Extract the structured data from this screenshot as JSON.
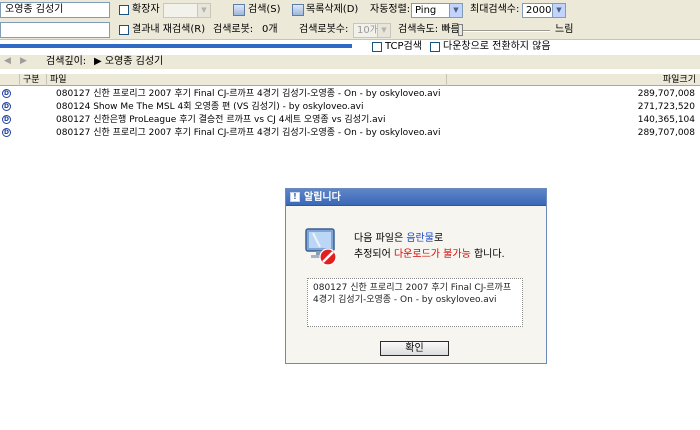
{
  "search": {
    "query": "오영종 김성기",
    "ext_checkbox_label": "확장자",
    "ext_select_value": "",
    "search_button_label": "검색(S)",
    "list_delete_label": "목록삭제(D)",
    "auto_sort_label": "자동정렬:",
    "auto_sort_value": "Ping",
    "max_results_label": "최대검색수:",
    "max_results_value": "2000개",
    "result_research_label": "결과내 재검색(R)",
    "result_count_label": "검색로봇:",
    "result_count_value": "0개",
    "robot_count_label": "검색로봇수:",
    "robot_count_value": "10개",
    "speed_label": "검색속도: 빠름",
    "speed_slow": "느림",
    "tcp_label": "TCP검색",
    "no_switch_label": "다운창으로 전환하지 않음"
  },
  "depth": {
    "label": "검색깊이:",
    "path": "▶ 오영종 김성기"
  },
  "grid": {
    "columns": [
      "구분",
      "파일",
      "파일크기"
    ],
    "rows": [
      {
        "name": "080127 신한 프로리그 2007 후기 Final CJ-르까프 4경기 김성기-오영종 - On - by oskyloveo.avi",
        "size": "289,707,008"
      },
      {
        "name": "080124 Show Me The MSL 4회 오영종 편 (VS 김성기) - by oskyloveo.avi",
        "size": "271,723,520"
      },
      {
        "name": "080127 신한은행 ProLeague 후기 결승전 르까프 vs CJ 4세트 오영종 vs 김성기.avi",
        "size": "140,365,104"
      },
      {
        "name": "080127 신한 프로리그 2007 후기 Final CJ-르까프 4경기 김성기-오영종 - On - by oskyloveo.avi",
        "size": "289,707,008"
      }
    ]
  },
  "dialog": {
    "title": "알립니다",
    "line1_pre": "다음 파일은 ",
    "line1_highlight": "음란물",
    "line1_post": "로",
    "line2_pre": "추정되어 ",
    "line2_highlight": "다운로드가 불가능",
    "line2_post": " 합니다.",
    "filename": "080127 신한 프로리그 2007 후기 Final CJ-르까프 4경기 김성기-오영종 - On - by oskyloveo.avi",
    "ok_label": "확인"
  },
  "colors": {
    "dialog_title_bg": "#3a68b7",
    "highlight_blue": "#1c46c8",
    "highlight_red": "#d10a0a",
    "progress": "#316ac5"
  }
}
